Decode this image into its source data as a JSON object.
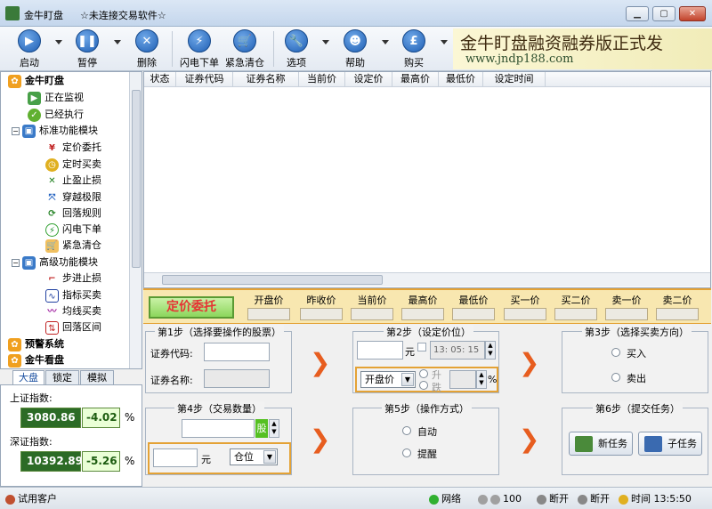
{
  "window": {
    "title": "金牛盯盘",
    "subtitle": "☆未连接交易软件☆"
  },
  "toolbar": {
    "buttons": [
      {
        "label": "启动",
        "icon": "play-icon"
      },
      {
        "label": "暂停",
        "icon": "pause-icon"
      },
      {
        "label": "删除",
        "icon": "delete-icon"
      },
      {
        "label": "闪电下单",
        "icon": "lightning-icon"
      },
      {
        "label": "紧急清仓",
        "icon": "cart-icon"
      },
      {
        "label": "选项",
        "icon": "wrench-icon"
      },
      {
        "label": "帮助",
        "icon": "user-icon"
      },
      {
        "label": "购买",
        "icon": "pound-icon"
      }
    ]
  },
  "banner": {
    "line1": "金牛盯盘融资融券版正式发",
    "line2": "www.jndp188.com"
  },
  "sidebar": {
    "root": "金牛盯盘",
    "monitoring": "正在监视",
    "executed": "已经执行",
    "standard_module": "标准功能模块",
    "standard_items": [
      "定价委托",
      "定时买卖",
      "止盈止损",
      "穿越极限",
      "回落规则",
      "闪电下单",
      "紧急清仓"
    ],
    "advanced_module": "高级功能模块",
    "advanced_items": [
      "步进止损",
      "指标买卖",
      "均线买卖",
      "回落区间"
    ],
    "alert": "预警系统",
    "watch": "金牛看盘"
  },
  "index_tabs": [
    "大盘",
    "锁定",
    "模拟"
  ],
  "indices": {
    "sh_label": "上证指数:",
    "sh_value": "3080.86",
    "sh_change": "-4.02",
    "sz_label": "深证指数:",
    "sz_value": "10392.89",
    "sz_change": "-5.26",
    "pct": "%"
  },
  "grid": {
    "columns": [
      "状态",
      "证券代码",
      "证券名称",
      "当前价",
      "设定价",
      "最高价",
      "最低价",
      "设定时间"
    ]
  },
  "price_strip": {
    "mode_button": "定价委托",
    "columns": [
      "开盘价",
      "昨收价",
      "当前价",
      "最高价",
      "最低价",
      "买一价",
      "买二价",
      "卖一价",
      "卖二价"
    ]
  },
  "step1": {
    "title": "第1步（选择要操作的股票）",
    "code_label": "证券代码:",
    "name_label": "证券名称:"
  },
  "step2": {
    "title": "第2步（设定价位）",
    "unit": "元",
    "time_value": "13: 05: 15",
    "price_type": "开盘价",
    "rise_label": "升",
    "fall_label": "跌",
    "pct": "%"
  },
  "step3": {
    "title": "第3步（选择买卖方向）",
    "buy": "买入",
    "sell": "卖出"
  },
  "step4": {
    "title": "第4步（交易数量）",
    "shares_unit": "股",
    "yuan_unit": "元",
    "position_select": "仓位"
  },
  "step5": {
    "title": "第5步（操作方式）",
    "auto": "自动",
    "remind": "提醒"
  },
  "step6": {
    "title": "第6步（提交任务）",
    "new_task": "新任务",
    "sub_task": "子任务"
  },
  "status": {
    "user": "试用客户",
    "network": "网络",
    "volume": "100",
    "disconnect1": "断开",
    "disconnect2": "断开",
    "time_label": "时间",
    "time": "13:5:50"
  },
  "colors": {
    "accent_orange": "#e75d1f",
    "index_bg": "#2c6b26",
    "mode_button_text": "#e63333"
  }
}
